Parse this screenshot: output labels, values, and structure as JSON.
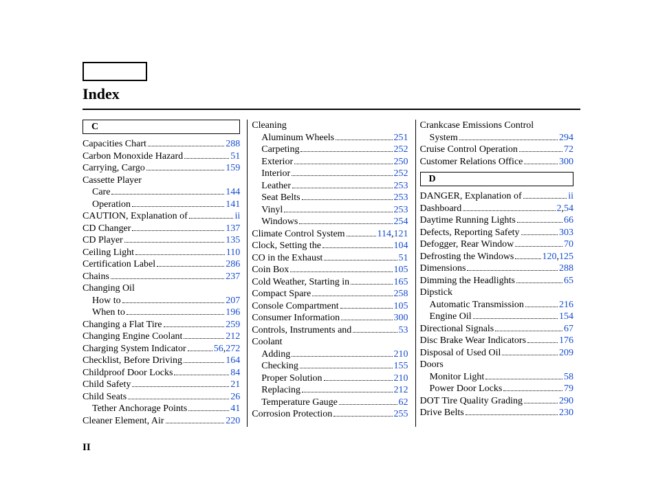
{
  "title": "Index",
  "page_number": "II",
  "sections": {
    "C_header": "C",
    "D_header": "D"
  },
  "col1": [
    {
      "type": "entry",
      "label": "Capacities Chart",
      "pages": [
        "288"
      ]
    },
    {
      "type": "entry",
      "label": "Carbon Monoxide Hazard",
      "pages": [
        "51"
      ]
    },
    {
      "type": "entry",
      "label": "Carrying, Cargo",
      "pages": [
        "159"
      ]
    },
    {
      "type": "plain",
      "label": "Cassette Player"
    },
    {
      "type": "entry",
      "sub": true,
      "label": "Care",
      "pages": [
        "144"
      ]
    },
    {
      "type": "entry",
      "sub": true,
      "label": "Operation",
      "pages": [
        "141"
      ]
    },
    {
      "type": "entry",
      "label": "CAUTION, Explanation of",
      "pages": [
        "ii"
      ]
    },
    {
      "type": "entry",
      "label": "CD Changer",
      "pages": [
        "137"
      ]
    },
    {
      "type": "entry",
      "label": "CD Player",
      "pages": [
        "135"
      ]
    },
    {
      "type": "entry",
      "label": "Ceiling Light",
      "pages": [
        "110"
      ]
    },
    {
      "type": "entry",
      "label": "Certification Label",
      "pages": [
        "286"
      ]
    },
    {
      "type": "entry",
      "label": "Chains",
      "pages": [
        "237"
      ]
    },
    {
      "type": "plain",
      "label": "Changing Oil"
    },
    {
      "type": "entry",
      "sub": true,
      "label": "How to",
      "pages": [
        "207"
      ]
    },
    {
      "type": "entry",
      "sub": true,
      "label": "When to",
      "pages": [
        "196"
      ]
    },
    {
      "type": "entry",
      "label": "Changing a Flat Tire",
      "pages": [
        "259"
      ]
    },
    {
      "type": "entry",
      "label": "Changing Engine Coolant",
      "pages": [
        "212"
      ]
    },
    {
      "type": "entry",
      "label": "Charging System Indicator",
      "pages": [
        "56",
        "272"
      ]
    },
    {
      "type": "entry",
      "label": "Checklist, Before Driving",
      "pages": [
        "164"
      ]
    },
    {
      "type": "entry",
      "label": "Childproof Door Locks",
      "pages": [
        "84"
      ]
    },
    {
      "type": "entry",
      "label": "Child Safety",
      "pages": [
        "21"
      ]
    },
    {
      "type": "entry",
      "label": "Child Seats",
      "pages": [
        "26"
      ]
    },
    {
      "type": "entry",
      "sub": true,
      "label": "Tether Anchorage Points",
      "pages": [
        "41"
      ]
    },
    {
      "type": "entry",
      "label": "Cleaner Element, Air",
      "pages": [
        "220"
      ]
    }
  ],
  "col2": [
    {
      "type": "plain",
      "label": "Cleaning"
    },
    {
      "type": "entry",
      "sub": true,
      "label": "Aluminum Wheels",
      "pages": [
        "251"
      ]
    },
    {
      "type": "entry",
      "sub": true,
      "label": "Carpeting",
      "pages": [
        "252"
      ]
    },
    {
      "type": "entry",
      "sub": true,
      "label": "Exterior",
      "pages": [
        "250"
      ]
    },
    {
      "type": "entry",
      "sub": true,
      "label": "Interior",
      "pages": [
        "252"
      ]
    },
    {
      "type": "entry",
      "sub": true,
      "label": "Leather",
      "pages": [
        "253"
      ]
    },
    {
      "type": "entry",
      "sub": true,
      "label": "Seat Belts",
      "pages": [
        "253"
      ]
    },
    {
      "type": "entry",
      "sub": true,
      "label": "Vinyl",
      "pages": [
        "253"
      ]
    },
    {
      "type": "entry",
      "sub": true,
      "label": "Windows",
      "pages": [
        "254"
      ]
    },
    {
      "type": "entry",
      "label": "Climate Control System",
      "pages": [
        "114",
        "121"
      ]
    },
    {
      "type": "entry",
      "label": "Clock, Setting the",
      "pages": [
        "104"
      ]
    },
    {
      "type": "entry",
      "label": "CO in the Exhaust",
      "pages": [
        "51"
      ]
    },
    {
      "type": "entry",
      "label": "Coin Box",
      "pages": [
        "105"
      ]
    },
    {
      "type": "entry",
      "label": "Cold Weather, Starting in",
      "pages": [
        "165"
      ]
    },
    {
      "type": "entry",
      "label": "Compact Spare",
      "pages": [
        "258"
      ]
    },
    {
      "type": "entry",
      "label": "Console Compartment",
      "pages": [
        "105"
      ]
    },
    {
      "type": "entry",
      "label": "Consumer Information",
      "pages": [
        "300"
      ]
    },
    {
      "type": "entry",
      "label": "Controls, Instruments and",
      "pages": [
        "53"
      ]
    },
    {
      "type": "plain",
      "label": "Coolant"
    },
    {
      "type": "entry",
      "sub": true,
      "label": "Adding",
      "pages": [
        "210"
      ]
    },
    {
      "type": "entry",
      "sub": true,
      "label": "Checking",
      "pages": [
        "155"
      ]
    },
    {
      "type": "entry",
      "sub": true,
      "label": "Proper Solution",
      "pages": [
        "210"
      ]
    },
    {
      "type": "entry",
      "sub": true,
      "label": "Replacing",
      "pages": [
        "212"
      ]
    },
    {
      "type": "entry",
      "sub": true,
      "label": "Temperature Gauge",
      "pages": [
        "62"
      ]
    },
    {
      "type": "entry",
      "label": "Corrosion Protection",
      "pages": [
        "255"
      ]
    }
  ],
  "col3a": [
    {
      "type": "entry",
      "label": "Crankcase Emissions Control System",
      "pages": [
        "294"
      ],
      "wrap": true
    },
    {
      "type": "entry",
      "label": "Cruise Control Operation",
      "pages": [
        "72"
      ]
    },
    {
      "type": "entry",
      "label": "Customer Relations Office",
      "pages": [
        "300"
      ]
    }
  ],
  "col3b": [
    {
      "type": "entry",
      "label": "DANGER, Explanation of",
      "pages": [
        "ii"
      ]
    },
    {
      "type": "entry",
      "label": "Dashboard",
      "pages": [
        "2",
        "54"
      ]
    },
    {
      "type": "entry",
      "label": "Daytime Running Lights",
      "pages": [
        "66"
      ]
    },
    {
      "type": "entry",
      "label": "Defects, Reporting Safety",
      "pages": [
        "303"
      ]
    },
    {
      "type": "entry",
      "label": "Defogger, Rear Window",
      "pages": [
        "70"
      ]
    },
    {
      "type": "entry",
      "label": "Defrosting the Windows",
      "pages": [
        "120",
        "125"
      ]
    },
    {
      "type": "entry",
      "label": "Dimensions",
      "pages": [
        "288"
      ]
    },
    {
      "type": "entry",
      "label": "Dimming the Headlights",
      "pages": [
        "65"
      ]
    },
    {
      "type": "plain",
      "label": "Dipstick"
    },
    {
      "type": "entry",
      "sub": true,
      "label": "Automatic Transmission",
      "pages": [
        "216"
      ]
    },
    {
      "type": "entry",
      "sub": true,
      "label": "Engine Oil",
      "pages": [
        "154"
      ]
    },
    {
      "type": "entry",
      "label": "Directional Signals",
      "pages": [
        "67"
      ]
    },
    {
      "type": "entry",
      "label": "Disc Brake Wear Indicators",
      "pages": [
        "176"
      ]
    },
    {
      "type": "entry",
      "label": "Disposal of Used Oil",
      "pages": [
        "209"
      ]
    },
    {
      "type": "plain",
      "label": "Doors"
    },
    {
      "type": "entry",
      "sub": true,
      "label": "Monitor Light",
      "pages": [
        "58"
      ]
    },
    {
      "type": "entry",
      "sub": true,
      "label": "Power Door Locks",
      "pages": [
        "79"
      ]
    },
    {
      "type": "entry",
      "label": "DOT Tire Quality Grading",
      "pages": [
        "290"
      ]
    },
    {
      "type": "entry",
      "label": "Drive Belts",
      "pages": [
        "230"
      ]
    }
  ]
}
